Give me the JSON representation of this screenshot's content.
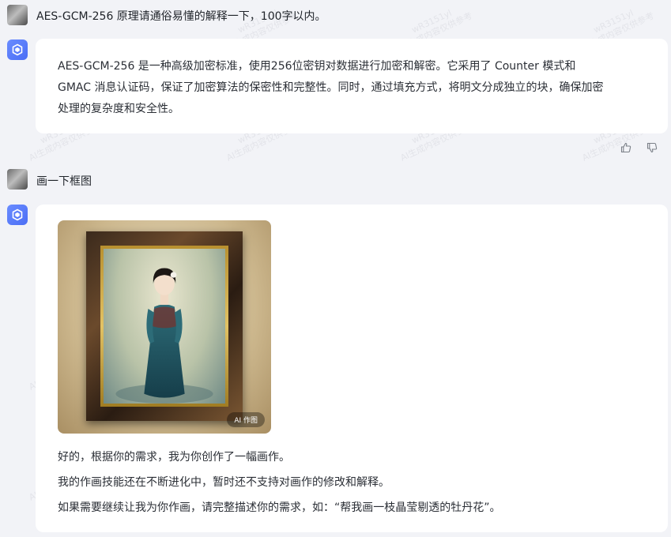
{
  "messages": [
    {
      "role": "user",
      "text": "AES-GCM-256 原理请通俗易懂的解释一下，100字以内。"
    },
    {
      "role": "assistant",
      "lines": [
        "AES-GCM-256 是一种高级加密标准，使用256位密钥对数据进行加密和解密。它采用了 Counter 模式和",
        "GMAC 消息认证码，保证了加密算法的保密性和完整性。同时，通过填充方式，将明文分成独立的块，确保加密",
        "处理的复杂度和安全性。"
      ]
    },
    {
      "role": "user",
      "text": "画一下框图"
    },
    {
      "role": "assistant",
      "image_badge": "AI 作图",
      "lines": [
        "好的，根据你的需求，我为你创作了一幅画作。",
        "我的作画技能还在不断进化中，暂时还不支持对画作的修改和解释。",
        "如果需要继续让我为你作画，请完整描述你的需求，如：“帮我画一枝晶莹剔透的牡丹花”。"
      ]
    }
  ],
  "watermark": {
    "line1": "wR3151yl",
    "line2": "AI生成内容仅供参考"
  },
  "icons": {
    "bot": "bot-logo-icon",
    "like": "thumbs-up-icon",
    "dislike": "thumbs-down-icon"
  },
  "colors": {
    "background": "#f2f3f7",
    "card": "#ffffff",
    "bot_accent": "#4b6ef5"
  }
}
